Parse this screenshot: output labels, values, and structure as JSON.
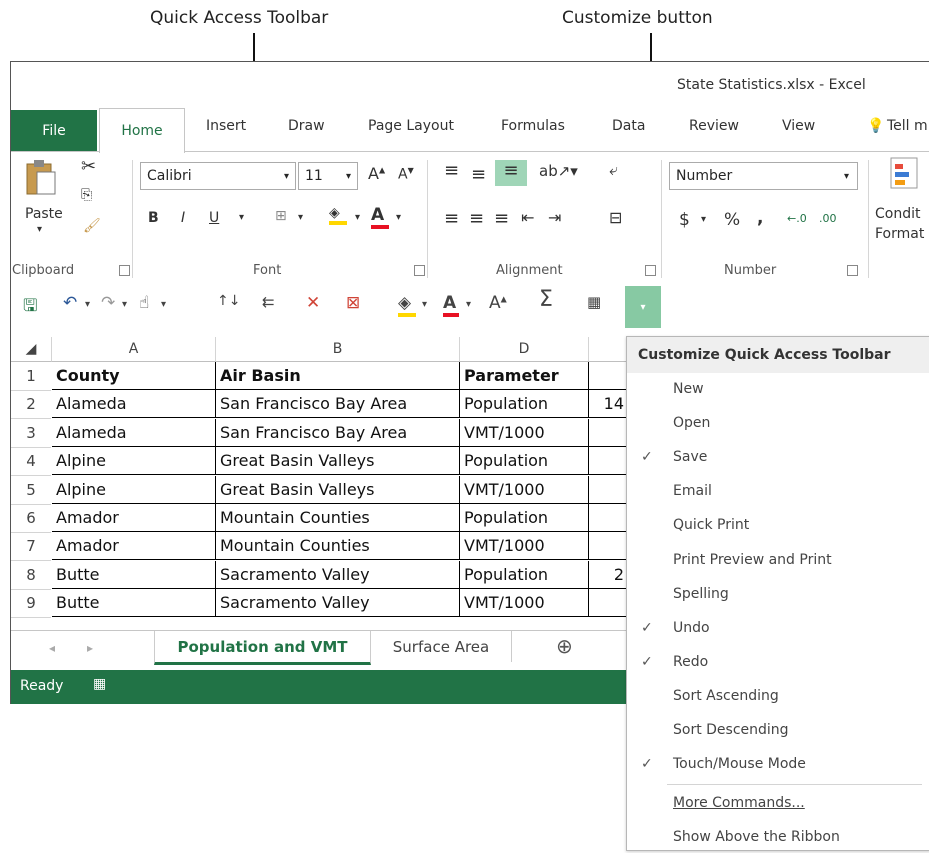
{
  "callouts": {
    "qat": "Quick Access Toolbar",
    "customize": "Customize button"
  },
  "window": {
    "title": "State Statistics.xlsx - Excel"
  },
  "ribbon_tabs": [
    "File",
    "Home",
    "Insert",
    "Draw",
    "Page Layout",
    "Formulas",
    "Data",
    "Review",
    "View",
    "Tell m"
  ],
  "ribbon": {
    "paste_label": "Paste",
    "font_name": "Calibri",
    "font_size": "11",
    "number_format": "Number",
    "bold": "B",
    "italic": "I",
    "underline": "U",
    "currency": "$",
    "percent": "%",
    "comma": ",",
    "conditional_formatting": "Condit\nFormat",
    "groups": {
      "clipboard": "Clipboard",
      "font": "Font",
      "alignment": "Alignment",
      "number": "Number"
    }
  },
  "grid": {
    "columns": [
      "A",
      "B",
      "D"
    ],
    "rows": [
      {
        "num": "1",
        "county": "County",
        "basin": "Air Basin",
        "param": "Parameter",
        "extra": ""
      },
      {
        "num": "2",
        "county": "Alameda",
        "basin": "San Francisco Bay Area",
        "param": "Population",
        "extra": "14"
      },
      {
        "num": "3",
        "county": "Alameda",
        "basin": "San Francisco Bay Area",
        "param": "VMT/1000",
        "extra": ""
      },
      {
        "num": "4",
        "county": "Alpine",
        "basin": "Great Basin Valleys",
        "param": "Population",
        "extra": ""
      },
      {
        "num": "5",
        "county": "Alpine",
        "basin": "Great Basin Valleys",
        "param": "VMT/1000",
        "extra": ""
      },
      {
        "num": "6",
        "county": "Amador",
        "basin": "Mountain Counties",
        "param": "Population",
        "extra": ""
      },
      {
        "num": "7",
        "county": "Amador",
        "basin": "Mountain Counties",
        "param": "VMT/1000",
        "extra": ""
      },
      {
        "num": "8",
        "county": "Butte",
        "basin": "Sacramento Valley",
        "param": "Population",
        "extra": "2"
      },
      {
        "num": "9",
        "county": "Butte",
        "basin": "Sacramento Valley",
        "param": "VMT/1000",
        "extra": ""
      }
    ]
  },
  "sheets": {
    "active": "Population and VMT",
    "other": "Surface Area",
    "add": "⊕"
  },
  "status": {
    "text": "Ready"
  },
  "menu": {
    "header": "Customize Quick Access Toolbar",
    "items": [
      {
        "label": "New",
        "checked": false
      },
      {
        "label": "Open",
        "checked": false
      },
      {
        "label": "Save",
        "checked": true
      },
      {
        "label": "Email",
        "checked": false
      },
      {
        "label": "Quick Print",
        "checked": false
      },
      {
        "label": "Print Preview and Print",
        "checked": false
      },
      {
        "label": "Spelling",
        "checked": false
      },
      {
        "label": "Undo",
        "checked": true
      },
      {
        "label": "Redo",
        "checked": true
      },
      {
        "label": "Sort Ascending",
        "checked": false
      },
      {
        "label": "Sort Descending",
        "checked": false
      },
      {
        "label": "Touch/Mouse Mode",
        "checked": true
      }
    ],
    "more_commands": "More Commands...",
    "show_above": "Show Above the Ribbon",
    "check_glyph": "✓"
  },
  "colors": {
    "excel_green": "#217346",
    "highlight_green": "#9fd5b7",
    "customize_btn": "#87c9a3"
  }
}
